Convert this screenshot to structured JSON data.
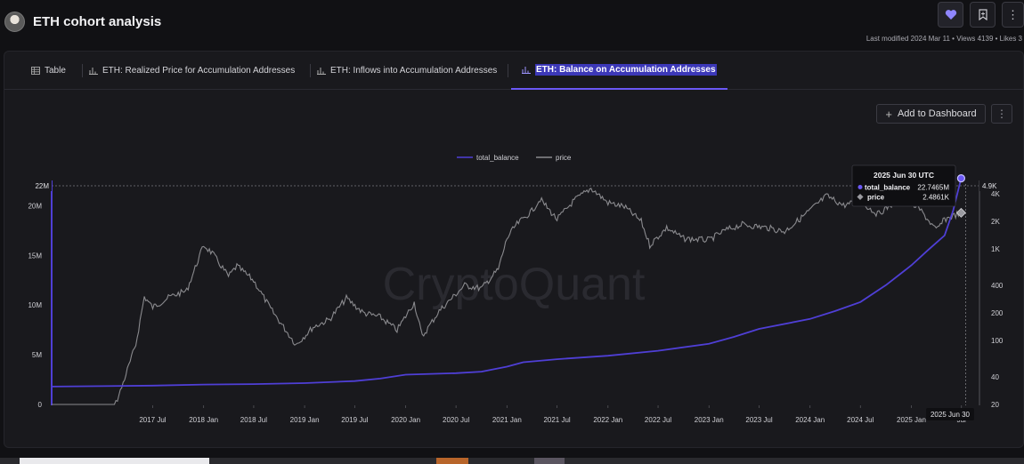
{
  "header": {
    "title": "ETH cohort analysis",
    "meta": "Last modified 2024 Mar 11 • Views 4139 • Likes 3"
  },
  "tabs": [
    {
      "label": "Table",
      "icon": "table-icon"
    },
    {
      "label": "ETH: Realized Price for Accumulation Addresses",
      "icon": "bar-chart-icon"
    },
    {
      "label": "ETH: Inflows into Accumulation Addresses",
      "icon": "bar-chart-icon"
    },
    {
      "label": "ETH: Balance on Accumulation Addresses",
      "icon": "bar-chart-icon",
      "active": true
    }
  ],
  "actions": {
    "add_dashboard": "Add to Dashboard"
  },
  "colors": {
    "accent": "#6b58f5",
    "balance_line": "#4f3fd6",
    "price_line": "#8a8a8e"
  },
  "chart_data": {
    "type": "line",
    "watermark": "CryptoQuant",
    "legend": [
      "total_balance",
      "price"
    ],
    "legend_position": "top-center",
    "x_ticks": [
      "2017 Jul",
      "2018 Jan",
      "2018 Jul",
      "2019 Jan",
      "2019 Jul",
      "2020 Jan",
      "2020 Jul",
      "2021 Jan",
      "2021 Jul",
      "2022 Jan",
      "2022 Jul",
      "2023 Jan",
      "2023 Jul",
      "2024 Jan",
      "2024 Jul",
      "2025 Jan",
      "Jul"
    ],
    "y_left_ticks": [
      "0",
      "5M",
      "10M",
      "15M",
      "20M"
    ],
    "y_left_max_label": "22M",
    "y_right_ticks": [
      "20",
      "40",
      "100",
      "200",
      "400",
      "1K",
      "2K",
      "4K"
    ],
    "y_right_max_label": "4.9K",
    "y_left_range": [
      0,
      22000000
    ],
    "y_right_scale": "log",
    "y_right_range": [
      20,
      4900
    ],
    "tooltip": {
      "date": "2025 Jun 30 UTC",
      "balance_label": "total_balance",
      "balance_value": "22.7465M",
      "price_label": "price",
      "price_value": "2.4861K"
    },
    "crosshair_date": "2025 Jun 30",
    "series": [
      {
        "name": "total_balance",
        "axis": "left",
        "points": [
          [
            "2016-07-01",
            1800000
          ],
          [
            "2017-07-01",
            1900000
          ],
          [
            "2018-01-01",
            2000000
          ],
          [
            "2018-07-01",
            2050000
          ],
          [
            "2019-01-01",
            2150000
          ],
          [
            "2019-07-01",
            2350000
          ],
          [
            "2019-10-01",
            2600000
          ],
          [
            "2020-01-01",
            3000000
          ],
          [
            "2020-07-01",
            3150000
          ],
          [
            "2020-10-01",
            3300000
          ],
          [
            "2021-01-01",
            3800000
          ],
          [
            "2021-03-01",
            4250000
          ],
          [
            "2021-07-01",
            4550000
          ],
          [
            "2022-01-01",
            4900000
          ],
          [
            "2022-07-01",
            5400000
          ],
          [
            "2023-01-01",
            6100000
          ],
          [
            "2023-04-01",
            6800000
          ],
          [
            "2023-07-01",
            7600000
          ],
          [
            "2024-01-01",
            8600000
          ],
          [
            "2024-04-01",
            9400000
          ],
          [
            "2024-07-01",
            10300000
          ],
          [
            "2024-10-01",
            12000000
          ],
          [
            "2025-01-01",
            14000000
          ],
          [
            "2025-03-01",
            15500000
          ],
          [
            "2025-05-01",
            17000000
          ],
          [
            "2025-06-01",
            19500000
          ],
          [
            "2025-06-30",
            22746500
          ]
        ]
      },
      {
        "name": "price",
        "axis": "right",
        "points": [
          [
            "2016-07-01",
            12
          ],
          [
            "2016-10-01",
            12
          ],
          [
            "2017-01-01",
            10
          ],
          [
            "2017-03-01",
            25
          ],
          [
            "2017-05-01",
            90
          ],
          [
            "2017-06-01",
            300
          ],
          [
            "2017-07-01",
            230
          ],
          [
            "2017-09-01",
            300
          ],
          [
            "2017-11-01",
            350
          ],
          [
            "2018-01-01",
            1100
          ],
          [
            "2018-02-01",
            900
          ],
          [
            "2018-04-01",
            500
          ],
          [
            "2018-05-01",
            650
          ],
          [
            "2018-07-01",
            450
          ],
          [
            "2018-09-01",
            220
          ],
          [
            "2018-12-01",
            90
          ],
          [
            "2019-02-01",
            140
          ],
          [
            "2019-04-01",
            170
          ],
          [
            "2019-06-01",
            290
          ],
          [
            "2019-08-01",
            200
          ],
          [
            "2019-10-01",
            180
          ],
          [
            "2019-12-01",
            130
          ],
          [
            "2020-02-01",
            260
          ],
          [
            "2020-03-01",
            110
          ],
          [
            "2020-05-01",
            210
          ],
          [
            "2020-08-01",
            400
          ],
          [
            "2020-10-01",
            370
          ],
          [
            "2020-12-01",
            600
          ],
          [
            "2021-01-01",
            1300
          ],
          [
            "2021-02-01",
            1800
          ],
          [
            "2021-04-01",
            2600
          ],
          [
            "2021-05-01",
            3500
          ],
          [
            "2021-07-01",
            2100
          ],
          [
            "2021-09-01",
            3400
          ],
          [
            "2021-11-01",
            4600
          ],
          [
            "2022-01-01",
            3200
          ],
          [
            "2022-03-01",
            2900
          ],
          [
            "2022-05-01",
            2000
          ],
          [
            "2022-06-01",
            1100
          ],
          [
            "2022-08-01",
            1700
          ],
          [
            "2022-10-01",
            1300
          ],
          [
            "2023-01-01",
            1250
          ],
          [
            "2023-03-01",
            1600
          ],
          [
            "2023-05-01",
            1850
          ],
          [
            "2023-08-01",
            1700
          ],
          [
            "2023-10-01",
            1550
          ],
          [
            "2023-12-01",
            2200
          ],
          [
            "2024-03-01",
            3800
          ],
          [
            "2024-05-01",
            3000
          ],
          [
            "2024-07-01",
            3300
          ],
          [
            "2024-09-01",
            2400
          ],
          [
            "2024-12-01",
            3700
          ],
          [
            "2025-02-01",
            2700
          ],
          [
            "2025-04-01",
            1600
          ],
          [
            "2025-05-01",
            2100
          ],
          [
            "2025-06-30",
            2486.1
          ]
        ]
      }
    ]
  }
}
